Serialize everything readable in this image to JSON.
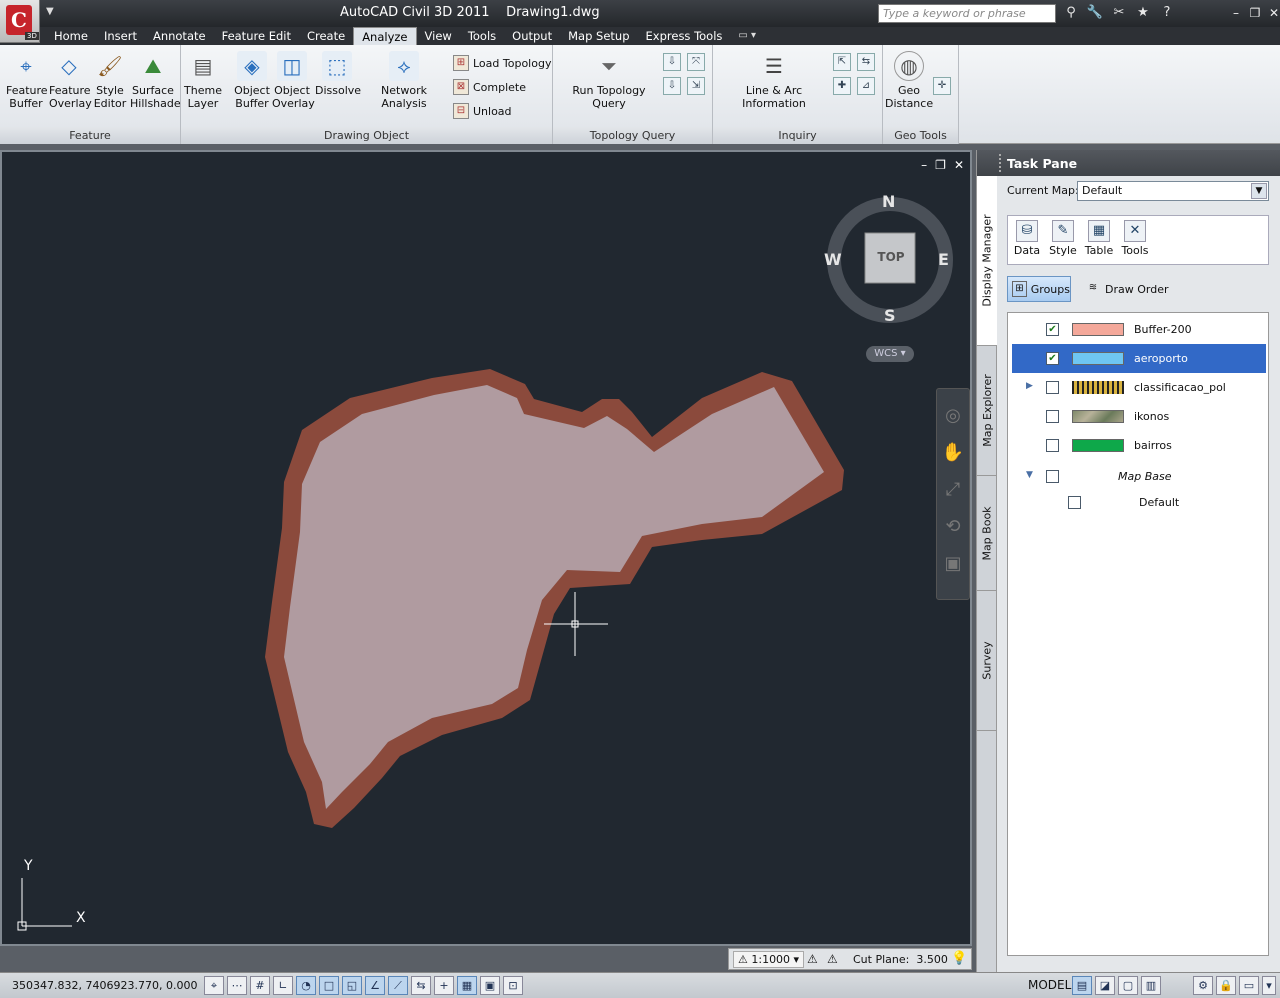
{
  "app": {
    "title": "AutoCAD Civil 3D 2011",
    "document": "Drawing1.dwg",
    "logo_letter": "C",
    "logo_tag": "3D"
  },
  "search": {
    "placeholder": "Type a keyword or phrase"
  },
  "tabs": [
    "Home",
    "Insert",
    "Annotate",
    "Feature Edit",
    "Create",
    "Analyze",
    "View",
    "Tools",
    "Output",
    "Map Setup",
    "Express Tools"
  ],
  "active_tab": "Analyze",
  "ribbon": {
    "panels": [
      {
        "title": "Feature",
        "buttons": [
          {
            "label1": "Feature",
            "label2": "Buffer"
          },
          {
            "label1": "Feature",
            "label2": "Overlay"
          },
          {
            "label1": "Style",
            "label2": "Editor"
          },
          {
            "label1": "Surface",
            "label2": "Hillshade"
          }
        ]
      },
      {
        "title": "Drawing Object",
        "buttons": [
          {
            "label1": "Theme",
            "label2": "Layer"
          },
          {
            "label1": "Object",
            "label2": "Buffer"
          },
          {
            "label1": "Object",
            "label2": "Overlay"
          },
          {
            "label1": "Dissolve",
            "label2": ""
          },
          {
            "label1": "Network Analysis",
            "label2": ""
          }
        ],
        "small": [
          "Load Topology",
          "Complete",
          "Unload"
        ]
      },
      {
        "title": "Topology Query",
        "buttons": [
          {
            "label1": "Run Topology Query",
            "label2": ""
          }
        ]
      },
      {
        "title": "Inquiry",
        "buttons": [
          {
            "label1": "Line & Arc Information",
            "label2": ""
          }
        ]
      },
      {
        "title": "Geo Tools",
        "buttons": [
          {
            "label1": "Geo",
            "label2": "Distance"
          }
        ]
      }
    ]
  },
  "viewcube": {
    "n": "N",
    "s": "S",
    "e": "E",
    "w": "W",
    "face": "TOP",
    "ucs": "WCS"
  },
  "ucs_icon": {
    "x": "X",
    "y": "Y"
  },
  "taskpane": {
    "title": "Task Pane",
    "vtabs": [
      "Display Manager",
      "Map Explorer",
      "Map Book",
      "Survey"
    ],
    "current_map_label": "Current Map:",
    "current_map_value": "Default",
    "tools": [
      "Data",
      "Style",
      "Table",
      "Tools"
    ],
    "groups_label": "Groups",
    "draw_order_label": "Draw Order",
    "layers": [
      {
        "name": "Buffer-200",
        "checked": true,
        "swatch": "#f4a89a"
      },
      {
        "name": "aeroporto",
        "checked": true,
        "swatch": "#6fc6f2",
        "selected": true
      },
      {
        "name": "classificacao_pol",
        "checked": false,
        "swatch": "pattern"
      },
      {
        "name": "ikonos",
        "checked": false,
        "swatch": "image"
      },
      {
        "name": "bairros",
        "checked": false,
        "swatch": "#0ea84a"
      },
      {
        "name": "Map Base",
        "checked": false,
        "swatch": "none",
        "italic": true
      },
      {
        "name": "Default",
        "checked": false,
        "swatch": "none"
      }
    ]
  },
  "statusbar": {
    "coords": "350347.832, 7406923.770, 0.000",
    "model": "MODEL",
    "scale": "1:1000",
    "cut_plane": "Cut Plane:  3.500"
  },
  "colors": {
    "drawing_bg": "#212830",
    "buffer": "#8b4a3c",
    "polygon": "#b09ba0"
  }
}
